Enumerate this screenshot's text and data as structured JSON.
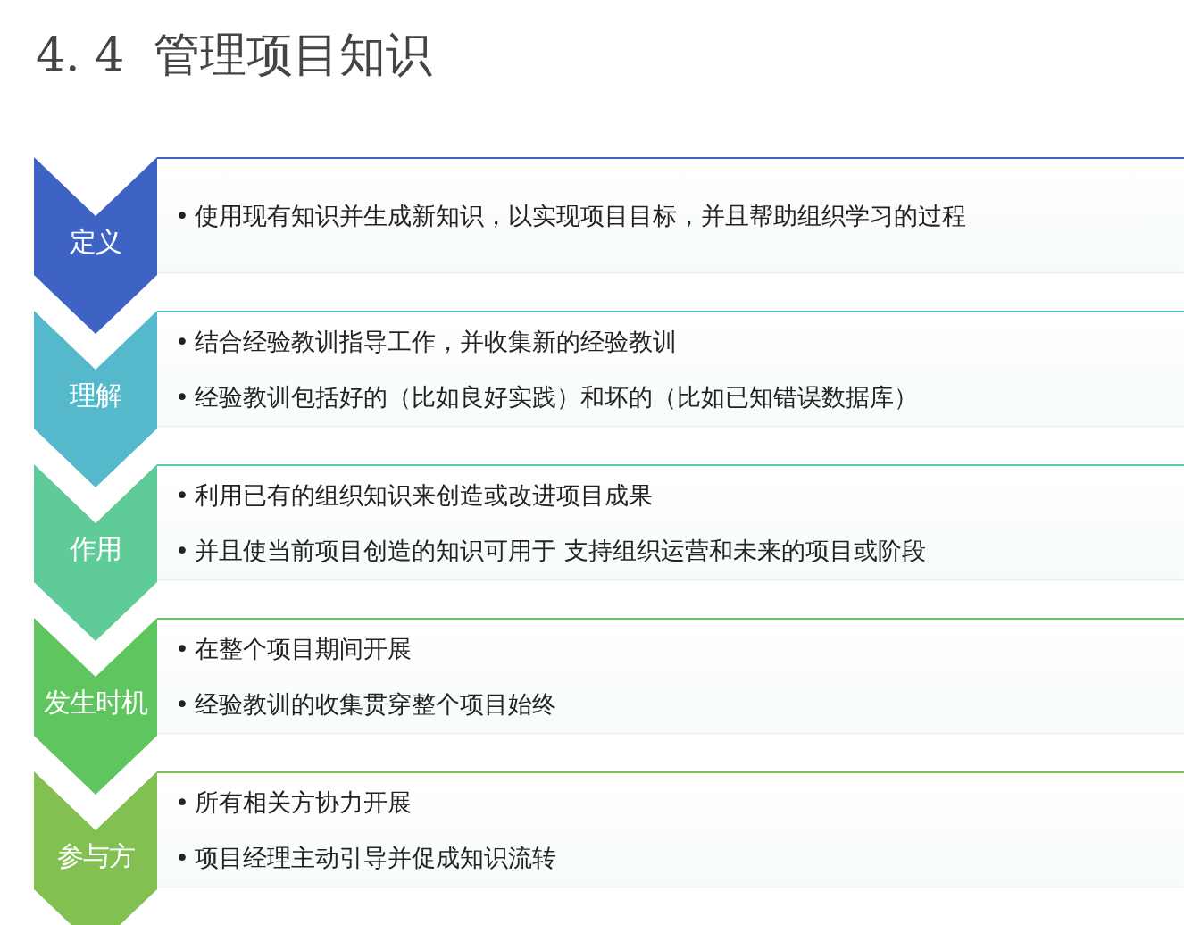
{
  "title": "4. 4  管理项目知识",
  "rows": [
    {
      "label": "定义",
      "color": "#3f63c4",
      "items": [
        {
          "bullet": "•",
          "text": "使用现有知识并生成新知识，以实现项目目标，并且帮助组织学习的过程"
        }
      ]
    },
    {
      "label": "理解",
      "color": "#55b9cb",
      "items": [
        {
          "bullet": "•",
          "text": "结合经验教训指导工作，并收集新的经验教训"
        },
        {
          "bullet": "•",
          "text": "经验教训包括好的（比如良好实践）和坏的（比如已知错误数据库）"
        }
      ]
    },
    {
      "label": "作用",
      "color": "#5fcb98",
      "items": [
        {
          "bullet": "•",
          "text": "利用已有的组织知识来创造或改进项目成果"
        },
        {
          "bullet": "•",
          "text": "并且使当前项目创造的知识可用于 支持组织运营和未来的项目或阶段"
        }
      ]
    },
    {
      "label": "发生时机",
      "color": "#5fc65f",
      "items": [
        {
          "bullet": "•",
          "text": "在整个项目期间开展"
        },
        {
          "bullet": "•",
          "text": "经验教训的收集贯穿整个项目始终"
        }
      ]
    },
    {
      "label": "参与方",
      "color": "#82c052",
      "items": [
        {
          "bullet": "•",
          "text": "所有相关方协力开展"
        },
        {
          "bullet": "•",
          "text": "项目经理主动引导并促成知识流转"
        }
      ]
    }
  ]
}
